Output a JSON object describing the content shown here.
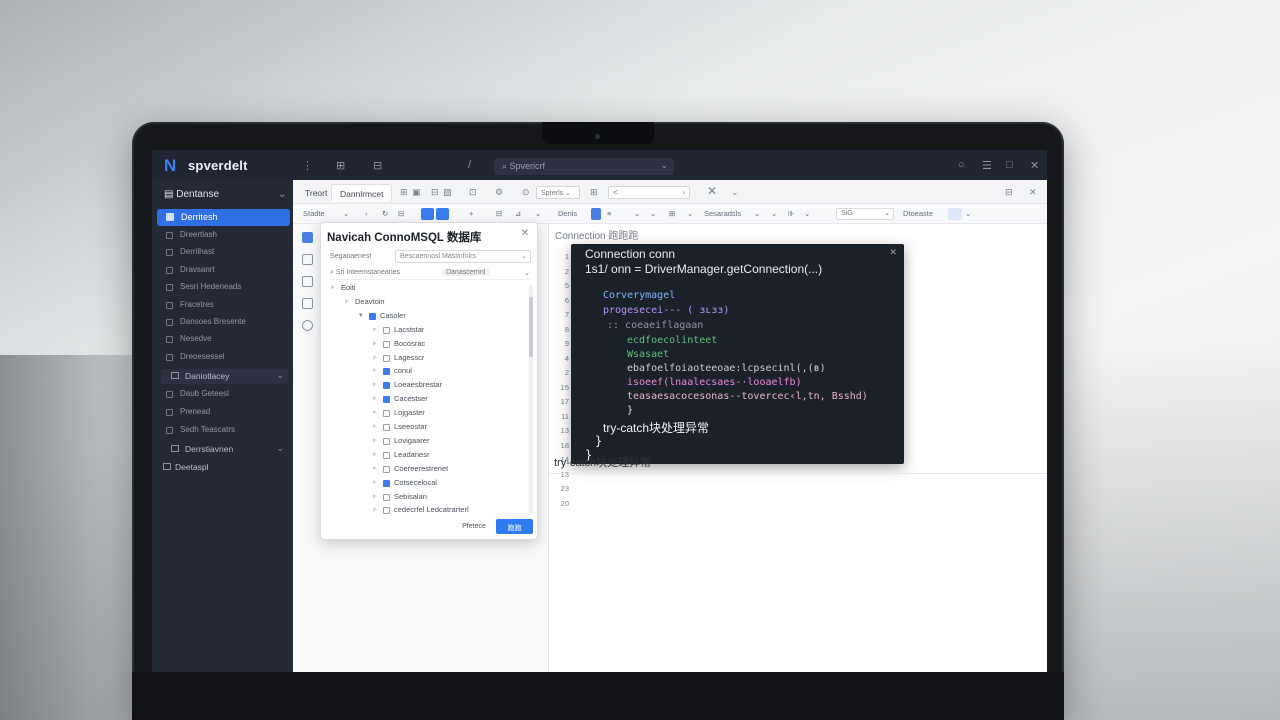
{
  "app": {
    "title": "spverdelt",
    "logo": "N",
    "search_label": "Spvericrf"
  },
  "sidebar": {
    "header": "Dentanse",
    "active_item": "Derritesh",
    "items_top": [
      "Dreertlash",
      "Derrilhast",
      "Dravsanrt",
      "Sesri Hedeneads",
      "Fracetres",
      "Dansoes Bresente",
      "Nesedve",
      "Dreoesessel"
    ],
    "groups": [
      {
        "label": "Daniotlacey"
      },
      {
        "label": "Derrstiavnen"
      },
      {
        "label": "Deetaspl"
      }
    ],
    "items_mid": [
      "Daub Geteesl",
      "Prenead",
      "Sedh Teascatrs"
    ]
  },
  "tabs": {
    "items": [
      "Treort",
      "Dannlrmcet"
    ],
    "select_label": "Sprerls",
    "input_label": "<"
  },
  "toolbar": {
    "left_label": "Stadte",
    "right_label": "Denis",
    "select1": "Sesaradsls",
    "select2": "SiG",
    "label3": "Dtoeaste"
  },
  "dialog": {
    "title": "Navicah ConnoMSQL 数据库",
    "label": "Segaoaenest",
    "select_value": "Bescaennosl Mastinfolrs",
    "row2_left": "Sri Inteemstaneanes",
    "row2_right": "Danascerrinl",
    "tree": [
      {
        "label": "Eoiti",
        "level": 0,
        "checkbox": false,
        "arrow": "▹"
      },
      {
        "label": "Deavtoin",
        "level": 1,
        "checkbox": false,
        "arrow": "▹"
      },
      {
        "label": "Casoler",
        "level": 2,
        "checkbox": true,
        "checked": true,
        "arrow": "▾"
      },
      {
        "label": "Lacststar",
        "level": 3,
        "checkbox": true,
        "checked": false,
        "arrow": "▹"
      },
      {
        "label": "Bocosrac",
        "level": 3,
        "checkbox": true,
        "checked": false,
        "arrow": "▹"
      },
      {
        "label": "Lagesscr",
        "level": 3,
        "checkbox": true,
        "checked": false,
        "arrow": "▹"
      },
      {
        "label": "conul",
        "level": 3,
        "checkbox": true,
        "checked": true,
        "arrow": "▹"
      },
      {
        "label": "Loeaesbrestar",
        "level": 3,
        "checkbox": true,
        "checked": true,
        "arrow": "▹"
      },
      {
        "label": "Cacestser",
        "level": 3,
        "checkbox": true,
        "checked": true,
        "arrow": "▹"
      },
      {
        "label": "Lojgaster",
        "level": 3,
        "checkbox": true,
        "checked": false,
        "arrow": "▹"
      },
      {
        "label": "Lseeostar",
        "level": 3,
        "checkbox": true,
        "checked": false,
        "arrow": "▹"
      },
      {
        "label": "Lovigaarer",
        "level": 3,
        "checkbox": true,
        "checked": false,
        "arrow": "▹"
      },
      {
        "label": "Leadanesr",
        "level": 3,
        "checkbox": true,
        "checked": false,
        "arrow": "▹"
      },
      {
        "label": "Coereerestrenet",
        "level": 3,
        "checkbox": true,
        "checked": false,
        "arrow": "▹"
      },
      {
        "label": "Cotsecelocal",
        "level": 3,
        "checkbox": true,
        "checked": true,
        "arrow": "▹"
      },
      {
        "label": "Sebisalan",
        "level": 3,
        "checkbox": true,
        "checked": false,
        "arrow": "▹"
      },
      {
        "label": "cedecrfel Ledcatrarterl",
        "level": 3,
        "checkbox": true,
        "checked": false,
        "arrow": "▹"
      }
    ],
    "cancel": "Pfetece",
    "ok": "跑跑"
  },
  "editor": {
    "header": "Connection 跑跑跑",
    "gutter": [
      "1",
      "2",
      "5",
      "6",
      "7",
      "8",
      "9",
      "4",
      "2",
      "15",
      "17",
      "11",
      "13",
      "18",
      "14",
      "13",
      "23",
      "20"
    ],
    "code": [
      {
        "text": "Connection conn",
        "color": "#e8ecf1",
        "indent": 14
      },
      {
        "text": "1s1/ onn = DriverManager.getConnection(...)",
        "color": "#e8ecf1",
        "indent": 14
      },
      {
        "text": "Corverymagel",
        "color": "#7fb2ff",
        "indent": 32
      },
      {
        "text": "progesecei--- ( ɜʟɜɜ)",
        "color": "#b494ff",
        "indent": 32
      },
      {
        "text": "::  coeaeiflagaan",
        "color": "#8c95a6",
        "indent": 36
      },
      {
        "text": "ecdfoecolinteet",
        "color": "#5fbf7f",
        "indent": 56
      },
      {
        "text": "Wsasaet",
        "color": "#5fbf7f",
        "indent": 56
      },
      {
        "text": "ebafoelfoiaoteeoae:lcpsecinl(,(ʙ)",
        "color": "#c8cfd8",
        "indent": 56
      },
      {
        "text": "isoeef(lnaalecsaes-·looaelfb)",
        "color": "#e98ad8",
        "indent": 56
      },
      {
        "text": "teasaesacocesonas--tovercec‹l,tn,  Bsshd)",
        "color": "#e8b4c8",
        "indent": 56
      },
      {
        "text": "}",
        "color": "#e8ecf1",
        "indent": 56
      },
      {
        "text": "try-catch块处理异常",
        "color": "#f1f3f6",
        "indent": 32
      },
      {
        "text": "}",
        "color": "#e8ecf1",
        "indent": 24
      },
      {
        "text": "}",
        "color": "#e8ecf1",
        "indent": 14
      }
    ],
    "bottom_text": "try-catch块处理异常"
  },
  "colors": {
    "accent": "#2f6fe4",
    "sidebar_bg": "#232a36",
    "titlebar_bg": "#1f2531",
    "code_bg": "#1b2129"
  }
}
